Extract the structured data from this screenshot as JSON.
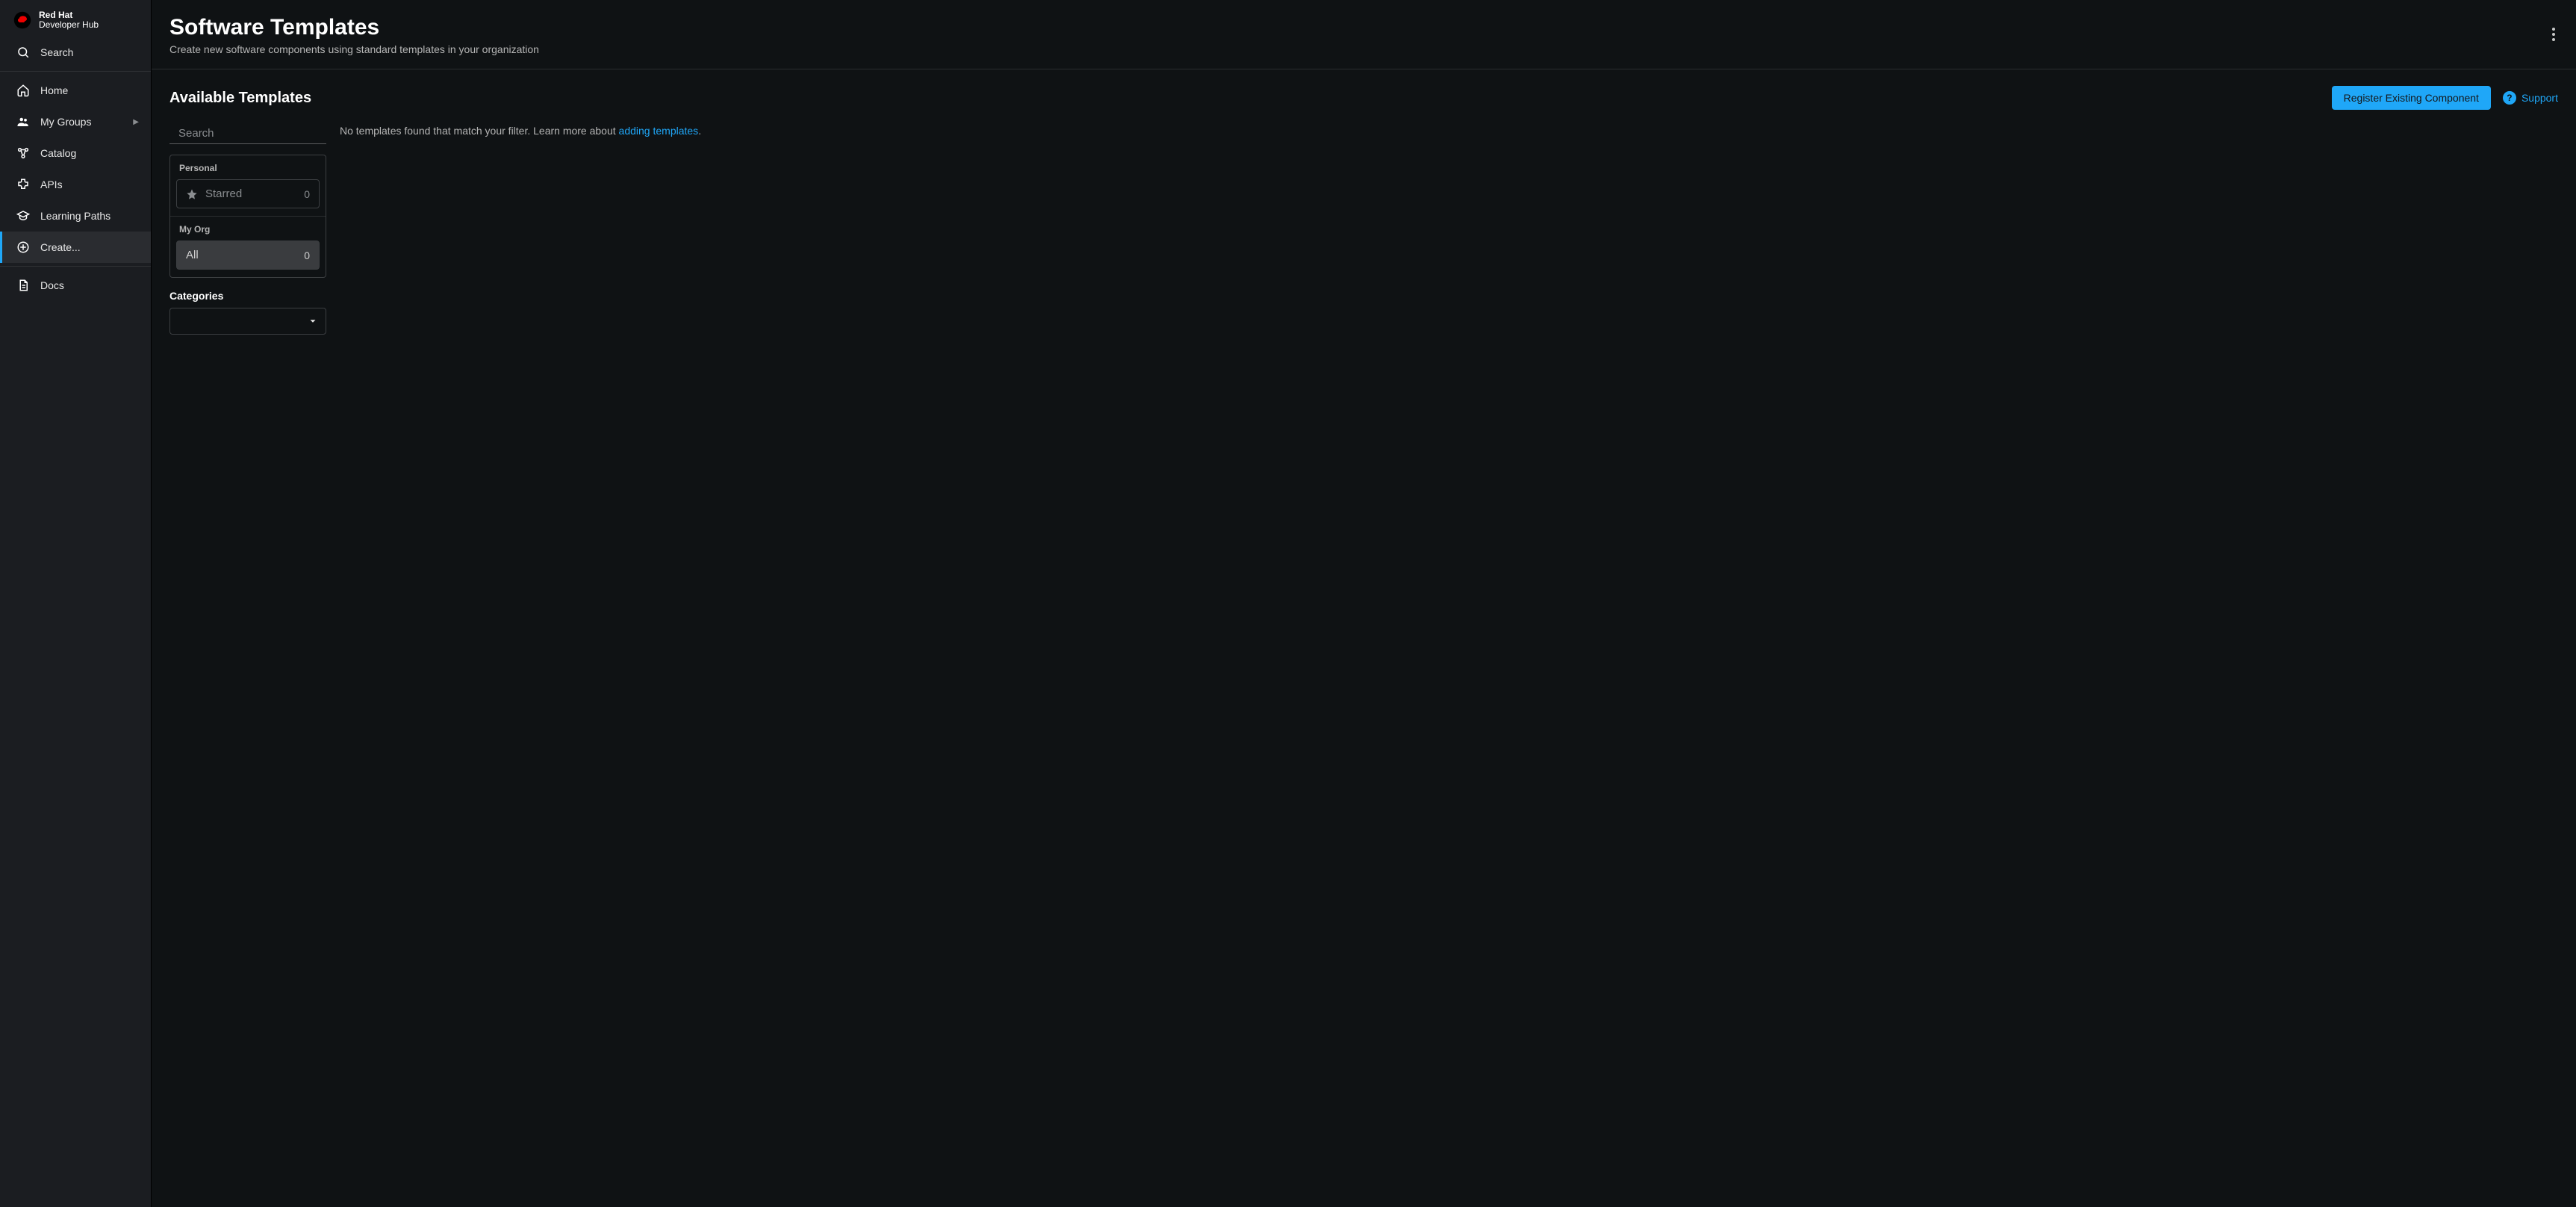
{
  "brand": {
    "line1": "Red Hat",
    "line2": "Developer Hub"
  },
  "sidebar": {
    "search_label": "Search",
    "items": [
      {
        "id": "home",
        "label": "Home",
        "icon": "home-icon",
        "has_submenu": false,
        "active": false
      },
      {
        "id": "my-groups",
        "label": "My Groups",
        "icon": "group-icon",
        "has_submenu": true,
        "active": false
      },
      {
        "id": "catalog",
        "label": "Catalog",
        "icon": "catalog-icon",
        "has_submenu": false,
        "active": false
      },
      {
        "id": "apis",
        "label": "APIs",
        "icon": "extension-icon",
        "has_submenu": false,
        "active": false
      },
      {
        "id": "learning-paths",
        "label": "Learning Paths",
        "icon": "learning-paths-icon",
        "has_submenu": false,
        "active": false
      },
      {
        "id": "create",
        "label": "Create...",
        "icon": "add-circle-icon",
        "has_submenu": false,
        "active": true
      }
    ],
    "docs_label": "Docs"
  },
  "header": {
    "title": "Software Templates",
    "subtitle": "Create new software components using standard templates in your organization"
  },
  "toolbar": {
    "section_title": "Available Templates",
    "register_button": "Register Existing Component",
    "support_label": "Support"
  },
  "filters": {
    "search_placeholder": "Search",
    "search_value": "",
    "personal_label": "Personal",
    "starred_label": "Starred",
    "starred_count": "0",
    "myorg_label": "My Org",
    "all_label": "All",
    "all_count": "0",
    "categories_label": "Categories",
    "categories_value": ""
  },
  "results": {
    "empty_prefix": "No templates found that match your filter. Learn more about ",
    "empty_link": "adding templates",
    "empty_suffix": "."
  }
}
